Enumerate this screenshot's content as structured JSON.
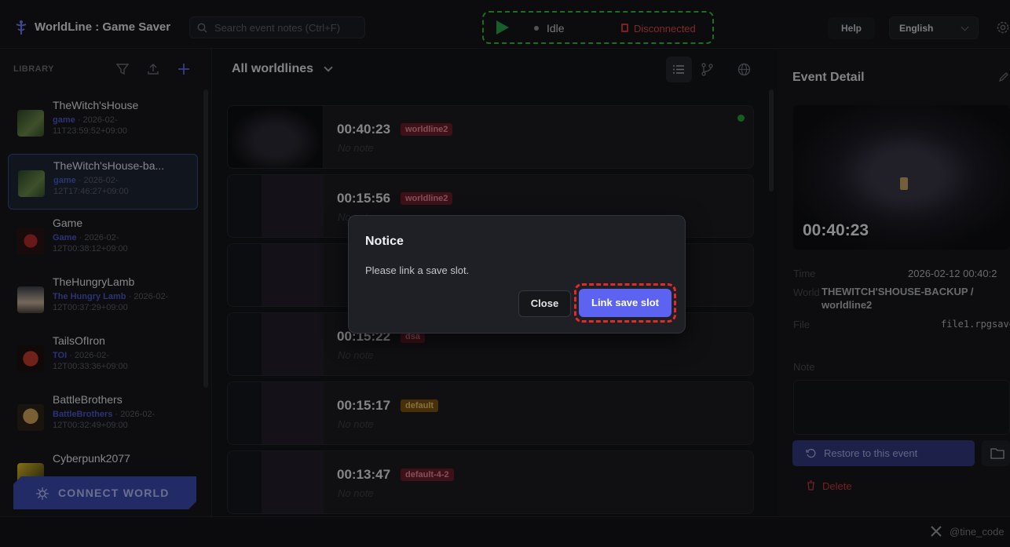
{
  "app": {
    "title": "WorldLine : Game Saver"
  },
  "search": {
    "placeholder": "Search event notes (Ctrl+F)"
  },
  "status": {
    "state": "Idle",
    "connection": "Disconnected",
    "accent_ok": "#2aa24b",
    "accent_error": "#e04646"
  },
  "header": {
    "help": "Help",
    "language": "English"
  },
  "library": {
    "label": "LIBRARY",
    "games": [
      {
        "name": "TheWitch'sHouse",
        "worldline": "game",
        "date": "2026-02-11T23:59:52+09:00"
      },
      {
        "name": "TheWitch'sHouse-ba...",
        "worldline": "game",
        "date": "2026-02-12T17:46:27+09:00"
      },
      {
        "name": "Game",
        "worldline": "Game",
        "date": "2026-02-12T00:38:12+09:00"
      },
      {
        "name": "TheHungryLamb",
        "worldline": "The Hungry Lamb",
        "date": "2026-02-12T00:37:29+09:00"
      },
      {
        "name": "TailsOfIron",
        "worldline": "TOI",
        "date": "2026-02-12T00:33:36+09:00"
      },
      {
        "name": "BattleBrothers",
        "worldline": "BattleBrothers",
        "date": "2026-02-12T00:32:49+09:00"
      },
      {
        "name": "Cyberpunk2077",
        "worldline": "",
        "date": ""
      }
    ],
    "connect_label": "CONNECT WORLD"
  },
  "timeline": {
    "selector": "All worldlines",
    "events": [
      {
        "time": "00:40:23",
        "tag": "worldline2",
        "tag_color": "red",
        "note": "No note"
      },
      {
        "time": "00:15:56",
        "tag": "worldline2",
        "tag_color": "red",
        "note": "No note"
      },
      {
        "time": "00:15:22",
        "tag": "dsa",
        "tag_color": "red",
        "note": "No note"
      },
      {
        "time": "00:15:17",
        "tag": "default",
        "tag_color": "gold",
        "note": "No note"
      },
      {
        "time": "00:13:47",
        "tag": "default-4-2",
        "tag_color": "red",
        "note": "No note"
      }
    ]
  },
  "detail": {
    "title": "Event Detail",
    "preview_time": "00:40:23",
    "time_label": "Time",
    "time_value": "2026-02-12 00:40:2",
    "world_label": "World",
    "world_value": "THEWITCH'SHOUSE-BACKUP /",
    "world_value_2": "worldline2",
    "file_label": "File",
    "file_value": "file1.rpgsave",
    "note_label": "Note",
    "restore_label": "Restore to this event",
    "delete_label": "Delete"
  },
  "footer": {
    "handle": "@tine_code"
  },
  "modal": {
    "title": "Notice",
    "message": "Please link a save slot.",
    "close_label": "Close",
    "link_label": "Link save slot"
  }
}
